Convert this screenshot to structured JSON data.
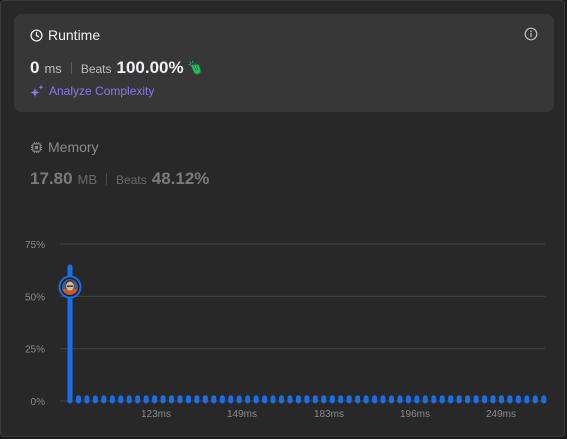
{
  "runtime": {
    "title": "Runtime",
    "value": "0",
    "unit": "ms",
    "beats_label": "Beats",
    "beats_value": "100.00%",
    "analyze_label": "Analyze Complexity"
  },
  "memory": {
    "title": "Memory",
    "value": "17.80",
    "unit": "MB",
    "beats_label": "Beats",
    "beats_value": "48.12%"
  },
  "colors": {
    "accent_blue": "#1a6fe8",
    "analyze_purple": "#8d75ee",
    "clap_green": "#2cbb5d"
  },
  "chart_data": {
    "type": "bar",
    "ylim": [
      0,
      75
    ],
    "yticks": [
      "0%",
      "25%",
      "50%",
      "75%"
    ],
    "xtick_labels": [
      "123ms",
      "149ms",
      "183ms",
      "196ms",
      "249ms"
    ],
    "highlighted_bar_index": 0,
    "values": [
      64,
      1.5,
      1.5,
      1.5,
      1.5,
      1.5,
      1.5,
      1.5,
      1.5,
      1.5,
      1.5,
      1.5,
      1.5,
      1.5,
      1.5,
      1.5,
      1.5,
      1.5,
      1.5,
      1.5,
      1.5,
      1.5,
      1.5,
      1.5,
      1.5,
      1.5,
      1.5,
      1.5,
      1.5,
      1.5,
      1.5,
      1.5,
      1.5,
      1.5,
      1.5,
      1.5,
      1.5,
      1.5,
      1.5,
      1.5,
      1.5,
      1.5,
      1.5,
      1.5,
      1.5,
      1.5,
      1.5,
      1.5,
      1.5,
      1.5,
      1.5,
      1.5,
      1.5,
      1.5,
      1.5,
      1.5,
      1.5
    ],
    "grid": true
  }
}
